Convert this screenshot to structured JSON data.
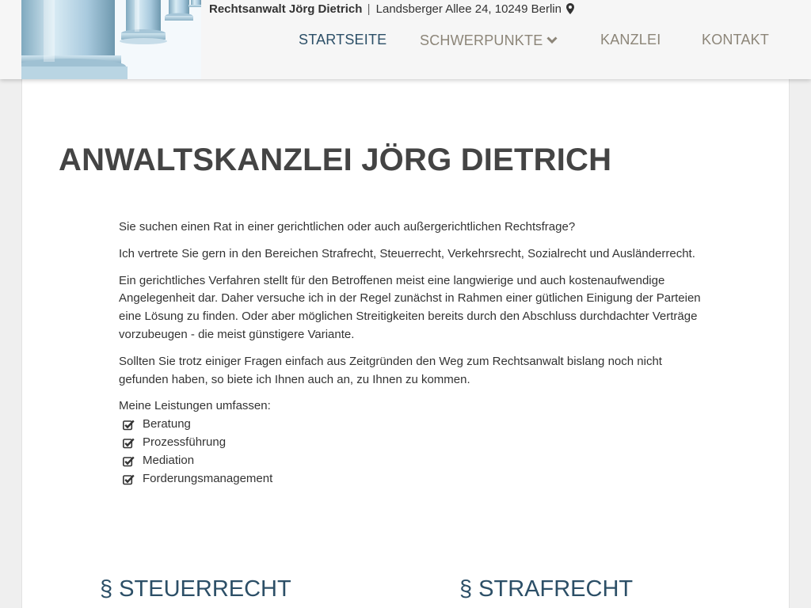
{
  "header": {
    "lawyer_name": "Rechtsanwalt Jörg Dietrich",
    "separator": "|",
    "address": "Landsberger Allee 24, 10249 Berlin",
    "pin_icon": "map-marker-icon"
  },
  "nav": {
    "items": [
      {
        "label": "STARTSEITE",
        "active": true
      },
      {
        "label": "SCHWERPUNKTE",
        "has_dropdown": true
      },
      {
        "label": "KANZLEI"
      },
      {
        "label": "KONTAKT"
      }
    ],
    "active_color": "#2c4f67",
    "inactive_color": "#8c8578"
  },
  "main": {
    "title": "ANWALTSKANZLEI JÖRG DIETRICH",
    "paragraphs": [
      "Sie suchen einen Rat in einer gerichtlichen oder auch außergerichtlichen Rechtsfrage?",
      "Ich vertrete Sie gern in den Bereichen Strafrecht, Steuerrecht, Verkehrsrecht, Sozialrecht und Ausländerrecht.",
      "Ein gerichtliches Verfahren stellt für den Betroffenen meist eine langwierige und auch kostenaufwendige Angelegenheit dar. Daher versuche ich in der Regel zunächst in Rahmen einer gütlichen Einigung der Parteien eine Lösung zu finden. Oder aber möglichen Streitigkeiten bereits durch den Abschluss durchdachter Verträge vorzubeugen - die meist günstigere Variante.",
      "Sollten Sie trotz einiger Fragen einfach aus Zeitgründen den Weg zum Rechtsanwalt bislang noch nicht gefunden haben, so biete ich Ihnen auch an, zu Ihnen zu kommen."
    ],
    "services_heading": "Meine Leistungen umfassen:",
    "services": [
      "Beratung",
      "Prozessführung",
      "Mediation",
      "Forderungsmanagement"
    ],
    "service_icon": "check-square-icon",
    "sections": [
      "§ STEUERRECHT",
      "§ STRAFRECHT"
    ]
  }
}
